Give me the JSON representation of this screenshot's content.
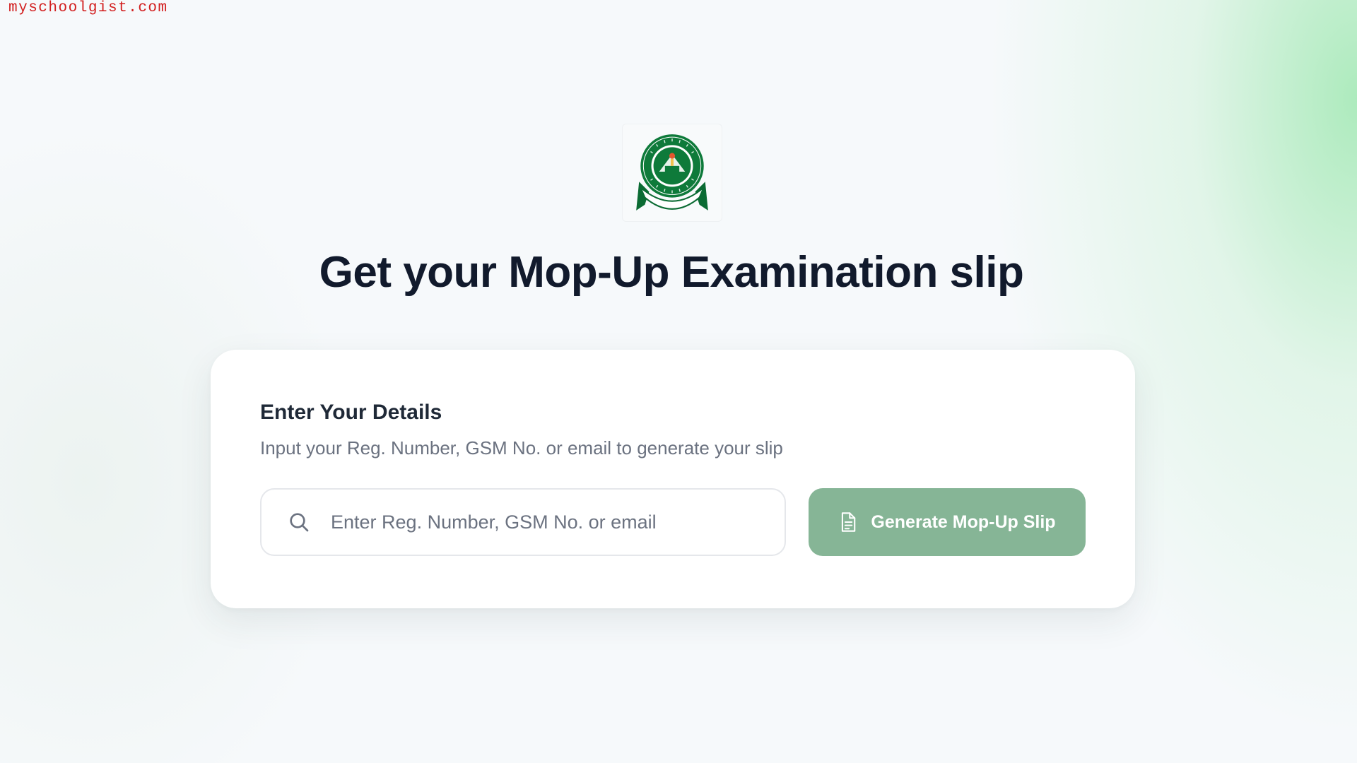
{
  "watermark": "myschoolgist.com",
  "logo": {
    "icon": "jamb-seal-logo",
    "text_top": "JOINT ADMISSIONS AND",
    "text_bottom": "MATRICULATION BOARD",
    "motto": "SERVICE AND INTEGRITY",
    "center_text": "JAMB",
    "colors": {
      "primary": "#0e7a3a",
      "ribbon": "#0b6b33"
    }
  },
  "page": {
    "title": "Get your Mop-Up Examination slip"
  },
  "form": {
    "title": "Enter Your Details",
    "subtitle": "Input your Reg. Number, GSM No. or email to generate your slip",
    "search": {
      "icon": "search-icon",
      "placeholder": "Enter Reg. Number, GSM No. or email",
      "value": ""
    },
    "button": {
      "icon": "document-icon",
      "label": "Generate Mop-Up Slip",
      "color": "#86b596"
    }
  }
}
